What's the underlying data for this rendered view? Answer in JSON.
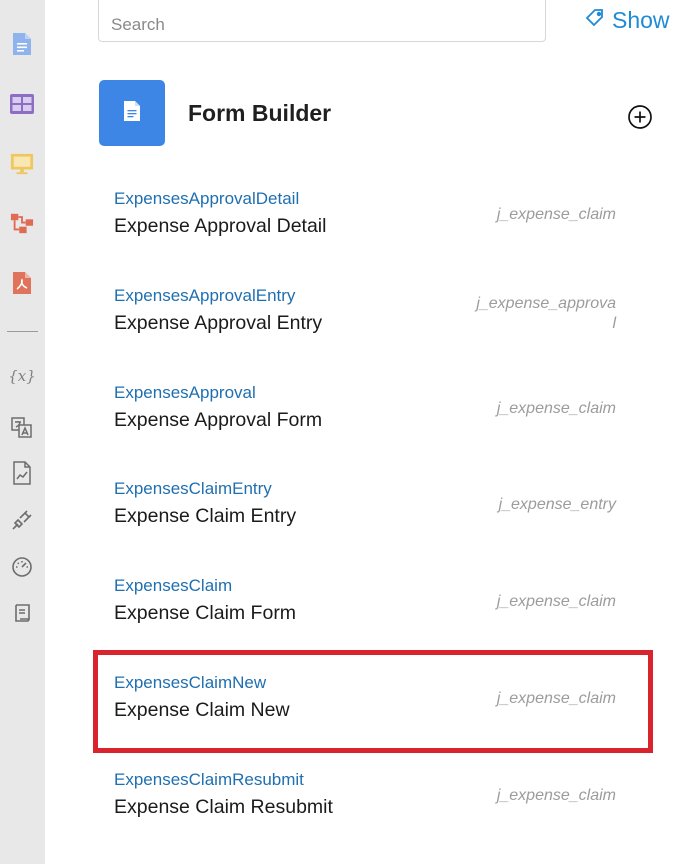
{
  "search": {
    "placeholder": "Search"
  },
  "show_button": {
    "label": "Show"
  },
  "header": {
    "title": "Form Builder"
  },
  "sidebar": {
    "icons": [
      "document-icon",
      "table-icon",
      "monitor-icon",
      "workflow-icon",
      "pdf-icon",
      "variables-icon",
      "translate-icon",
      "report-icon",
      "plugin-icon",
      "dashboard-icon",
      "scroll-icon"
    ],
    "variables_glyph": "{x}"
  },
  "forms": [
    {
      "code": "ExpensesApprovalDetail",
      "title": "Expense Approval Detail",
      "table": "j_expense_claim"
    },
    {
      "code": "ExpensesApprovalEntry",
      "title": "Expense Approval Entry",
      "table": "j_expense_approval"
    },
    {
      "code": "ExpensesApproval",
      "title": "Expense Approval Form",
      "table": "j_expense_claim"
    },
    {
      "code": "ExpensesClaimEntry",
      "title": "Expense Claim Entry",
      "table": "j_expense_entry"
    },
    {
      "code": "ExpensesClaim",
      "title": "Expense Claim Form",
      "table": "j_expense_claim"
    },
    {
      "code": "ExpensesClaimNew",
      "title": "Expense Claim New",
      "table": "j_expense_claim"
    },
    {
      "code": "ExpensesClaimResubmit",
      "title": "Expense Claim Resubmit",
      "table": "j_expense_claim"
    }
  ],
  "colors": {
    "accent": "#1f8ad6",
    "tile": "#3e86e5",
    "code_text": "#1f6fb0",
    "highlight": "#d9232d",
    "sidebar_bg": "#e8e8e8"
  }
}
